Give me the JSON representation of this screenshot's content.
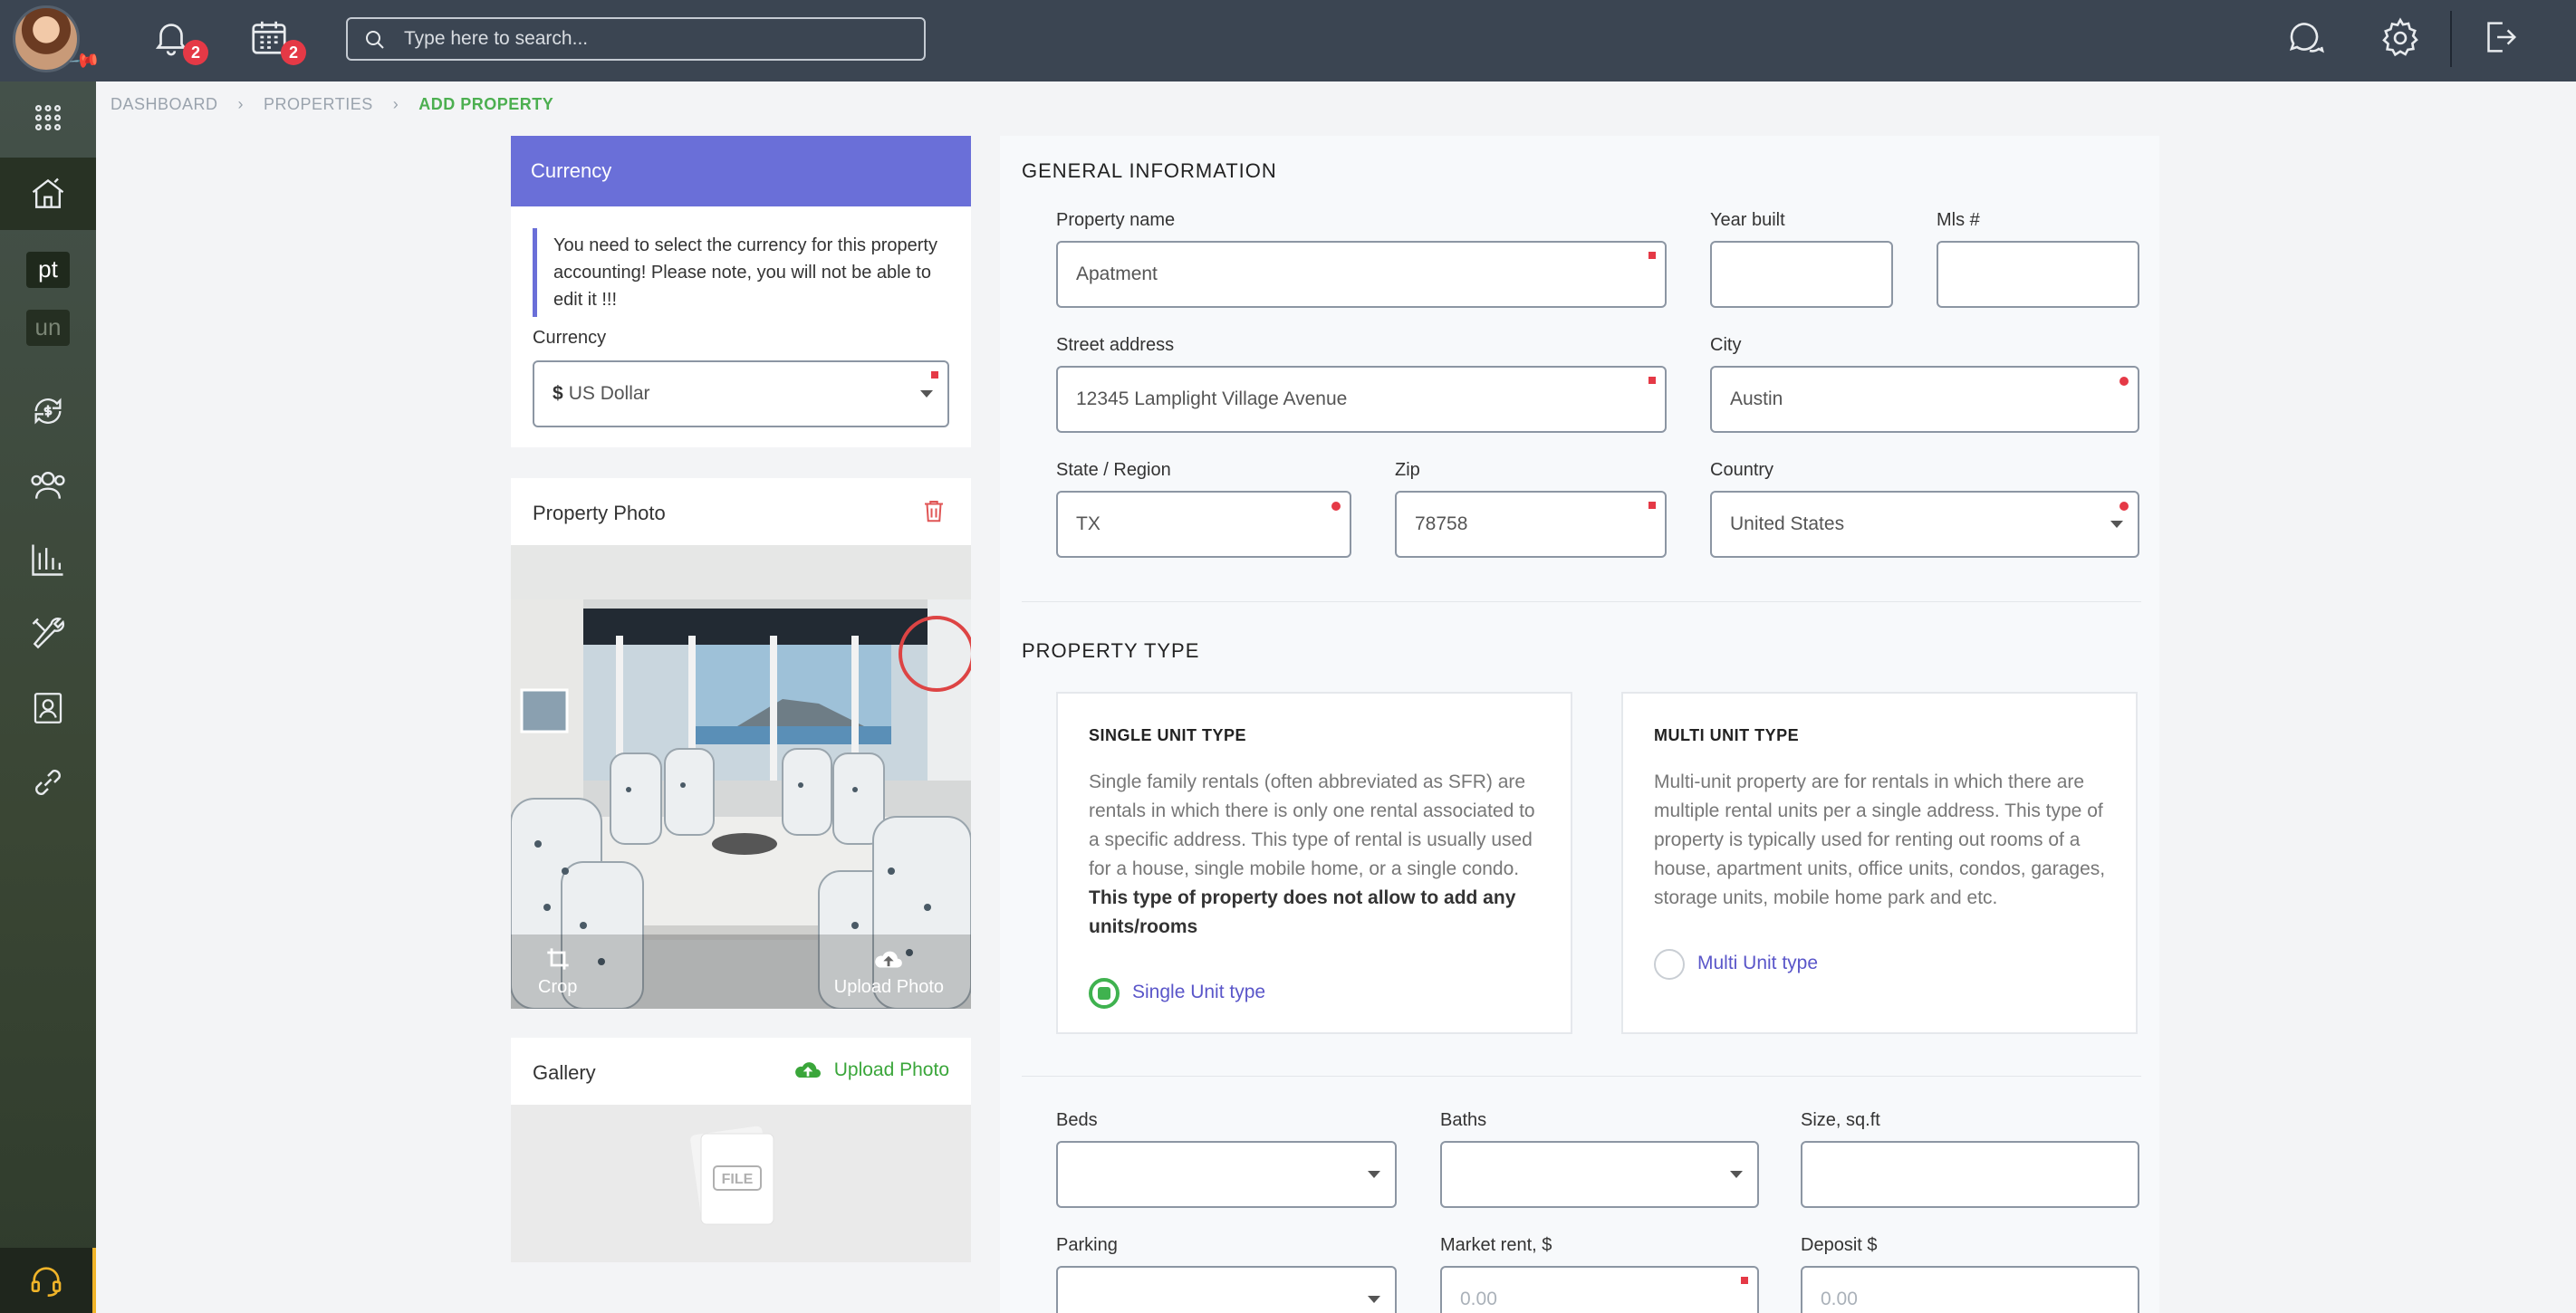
{
  "topbar": {
    "notifications_count": "2",
    "calendar_count": "2",
    "search_placeholder": "Type here to search..."
  },
  "breadcrumb": {
    "items": [
      "DASHBOARD",
      "PROPERTIES",
      "ADD PROPERTY"
    ]
  },
  "sidebar": {
    "text_items": [
      "pt",
      "un"
    ]
  },
  "currency": {
    "header": "Currency",
    "note": "You need to select the currency for this property accounting! Please note, you will not be able to edit it !!!",
    "label": "Currency",
    "symbol": "$",
    "value": "US Dollar"
  },
  "photo": {
    "title": "Property Photo",
    "crop_label": "Crop",
    "upload_label": "Upload Photo"
  },
  "gallery": {
    "title": "Gallery",
    "upload_label": "Upload Photo",
    "file_label": "FILE"
  },
  "general": {
    "title": "GENERAL INFORMATION",
    "property_name_label": "Property name",
    "property_name_value": "Apatment",
    "year_built_label": "Year built",
    "year_built_value": "",
    "mls_label": "Mls #",
    "mls_value": "",
    "street_label": "Street address",
    "street_value": "12345 Lamplight Village Avenue",
    "city_label": "City",
    "city_value": "Austin",
    "state_label": "State / Region",
    "state_value": "TX",
    "zip_label": "Zip",
    "zip_value": "78758",
    "country_label": "Country",
    "country_value": "United States"
  },
  "property_type": {
    "title": "PROPERTY TYPE",
    "single": {
      "heading": "SINGLE UNIT TYPE",
      "description": "Single family rentals (often abbreviated as SFR) are rentals in which there is only one rental associated to a specific address. This type of rental is usually used for a house, single mobile home, or a single condo.",
      "description_bold": "This type of property does not allow to add any units/rooms",
      "radio_label": "Single Unit type",
      "selected": true
    },
    "multi": {
      "heading": "MULTI UNIT TYPE",
      "description": "Multi-unit property are for rentals in which there are multiple rental units per a single address. This type of property is typically used for renting out rooms of a house, apartment units, office units, condos, garages, storage units, mobile home park and etc.",
      "radio_label": "Multi Unit type",
      "selected": false
    }
  },
  "details": {
    "beds_label": "Beds",
    "baths_label": "Baths",
    "size_label": "Size, sq.ft",
    "parking_label": "Parking",
    "market_rent_label": "Market rent, $",
    "market_rent_placeholder": "0.00",
    "deposit_label": "Deposit $",
    "deposit_placeholder": "0.00"
  },
  "colors": {
    "topbar": "#3b4552",
    "sidebar": "#3a4634",
    "accent_purple": "#6a6fd8",
    "accent_green": "#4caf50",
    "badge_red": "#e53946",
    "support_yellow": "#f0b429"
  }
}
